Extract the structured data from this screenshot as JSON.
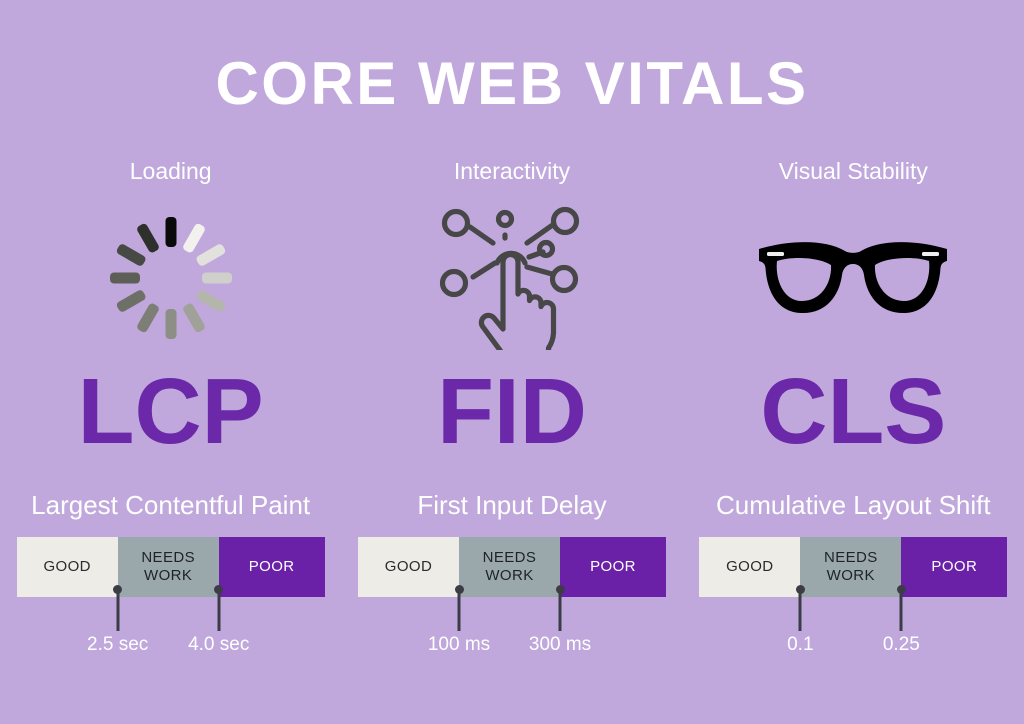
{
  "title": "CORE WEB VITALS",
  "theme": {
    "background": "#c0a8dc",
    "accent_purple": "#6b28a8",
    "good_color": "#eeece7",
    "needs_work_color": "#9aa8ab",
    "poor_color": "#6a21a8",
    "text_white": "#ffffff",
    "marker_color": "#3c3c46"
  },
  "columns": [
    {
      "category": "Loading",
      "icon": "loading-spinner-icon",
      "acronym": "LCP"
    },
    {
      "category": "Interactivity",
      "icon": "hand-tap-network-icon",
      "acronym": "FID"
    },
    {
      "category": "Visual Stability",
      "icon": "eyeglasses-icon",
      "acronym": "CLS"
    }
  ],
  "metrics": [
    {
      "title": "Largest Contentful Paint",
      "bands": [
        {
          "label": "GOOD"
        },
        {
          "label": "NEEDS WORK"
        },
        {
          "label": "POOR"
        }
      ],
      "thresholds": [
        {
          "value": "2.5 sec",
          "position_pct": 32.8
        },
        {
          "value": "4.0 sec",
          "position_pct": 65.6
        }
      ]
    },
    {
      "title": "First Input Delay",
      "bands": [
        {
          "label": "GOOD"
        },
        {
          "label": "NEEDS WORK"
        },
        {
          "label": "POOR"
        }
      ],
      "thresholds": [
        {
          "value": "100 ms",
          "position_pct": 32.8
        },
        {
          "value": "300 ms",
          "position_pct": 65.6
        }
      ]
    },
    {
      "title": "Cumulative Layout Shift",
      "bands": [
        {
          "label": "GOOD"
        },
        {
          "label": "NEEDS WORK"
        },
        {
          "label": "POOR"
        }
      ],
      "thresholds": [
        {
          "value": "0.1",
          "position_pct": 32.8
        },
        {
          "value": "0.25",
          "position_pct": 65.6
        }
      ]
    }
  ],
  "spinner_segments": [
    "#0a0a0a",
    "#f2f1ee",
    "#e2e1de",
    "#cfcfcc",
    "#b4b5ad",
    "#a0a29a",
    "#8d8f87",
    "#7d7f76",
    "#6e7068",
    "#5d5f57",
    "#474a44",
    "#2e302c"
  ]
}
